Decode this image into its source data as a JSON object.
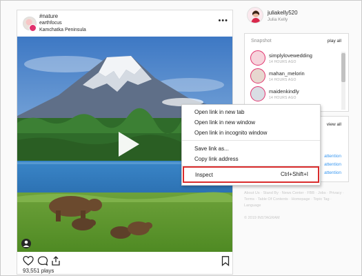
{
  "post": {
    "tag": "#nature",
    "username": "earthfocus",
    "location": "Kamchatka Peninsula",
    "more": "•••",
    "plays": "93,551 plays"
  },
  "profile": {
    "username": "juliakelly520",
    "full_name": "Julia Kelly"
  },
  "snapshot": {
    "title": "Snapshot",
    "play_all": "play all",
    "items": [
      {
        "name": "simplylovewedding",
        "time": "14 HOURS AGO"
      },
      {
        "name": "mahan_melorin",
        "time": "14 HOURS AGO"
      },
      {
        "name": "maidenkindly",
        "time": "14 HOURS AGO"
      }
    ]
  },
  "suggestions": {
    "view_all": "view all",
    "actions": [
      "attention",
      "attention",
      "attention"
    ]
  },
  "footer": {
    "links": "About Us · Stand By · News Center · FBB · Jobs · Privacy · Terms · Table Of Contents · Homepage · Topic Tag · Language",
    "copyright": "© 2019 INSTAGRAM"
  },
  "context_menu": {
    "items": [
      "Open link in new tab",
      "Open link in new window",
      "Open link in incognito window",
      "Save link as...",
      "Copy link address"
    ],
    "inspect": "Inspect",
    "inspect_shortcut": "Ctrl+Shift+I"
  },
  "colors": {
    "accent": "#e1306c",
    "link_blue": "#3897f0",
    "highlight_red": "#d92b2b"
  }
}
